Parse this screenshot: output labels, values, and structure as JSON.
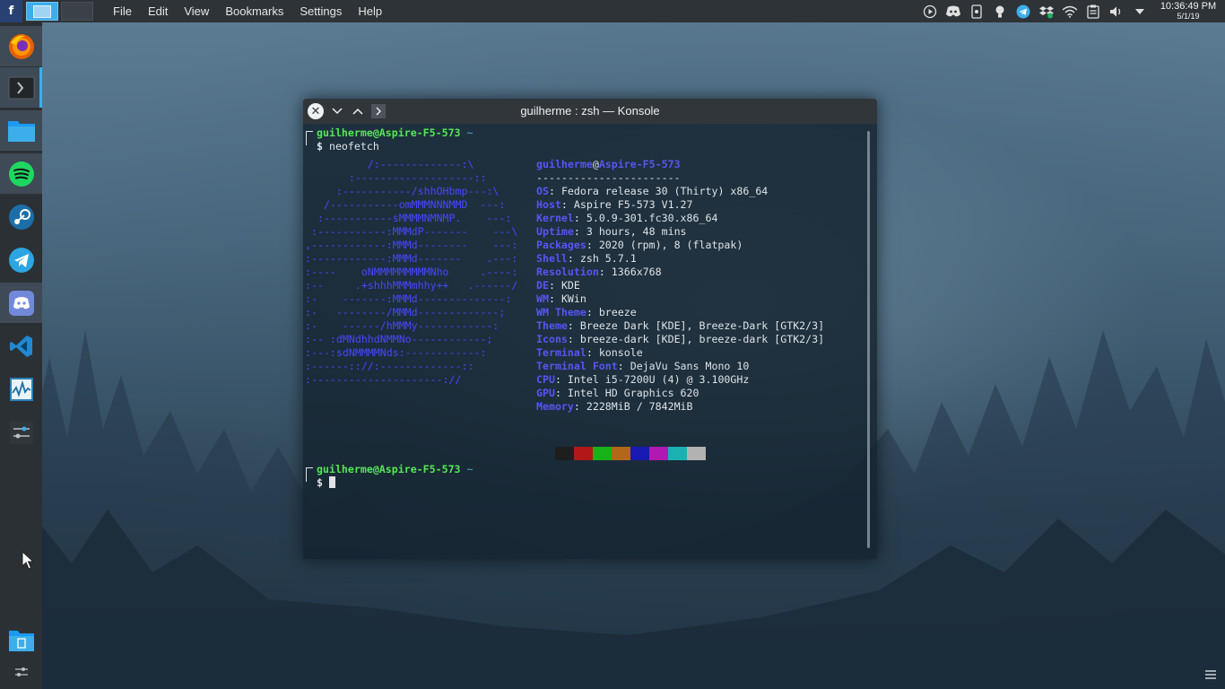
{
  "top_panel": {
    "menu": [
      "File",
      "Edit",
      "View",
      "Bookmarks",
      "Settings",
      "Help"
    ],
    "clock": {
      "time": "10:36:49 PM",
      "date": "5/1/19"
    },
    "tray_icons": [
      "media-play-icon",
      "discord-icon",
      "kde-connect-icon",
      "lightbulb-icon",
      "telegram-icon",
      "dropbox-icon",
      "wifi-icon",
      "clipboard-icon",
      "volume-icon",
      "tray-expand-icon"
    ]
  },
  "dock": {
    "items": [
      "firefox-icon",
      "terminal-icon",
      "file-manager-icon",
      "spotify-icon",
      "steam-icon",
      "telegram-icon",
      "discord-icon",
      "vscode-icon",
      "system-monitor-icon",
      "settings-icon",
      "trash-icon"
    ]
  },
  "window": {
    "title": "guilherme : zsh — Konsole"
  },
  "terminal": {
    "prompt_user": "guilherme@Aspire-F5-573",
    "prompt_dir": "~",
    "prompt_symbol": "$",
    "command": "neofetch",
    "ascii": [
      "          /:-------------:\\",
      "       :-------------------::",
      "     :-----------/shhOHbmp---:\\",
      "   /-----------omMMMNNNMMD  ---:",
      "  :-----------sMMMMNMNMP.    ---:",
      " :-----------:MMMdP-------    ---\\",
      ",------------:MMMd--------    ---:",
      ":------------:MMMd-------    .---:",
      ":----    oNMMMMMMMMMNho     .----:",
      ":--     .+shhhMMMmhhy++   .------/",
      ":-    -------:MMMd--------------:",
      ":-   --------/MMMd-------------;",
      ":-    ------/hMMMy------------:",
      ":-- :dMNdhhdNMMNo------------;",
      ":---:sdNMMMMNds:------------:",
      ":------:://:-------------::",
      ":---------------------://"
    ],
    "info_user": "guilherme",
    "info_at": "@",
    "info_host": "Aspire-F5-573",
    "info_sep": "-----------------------",
    "info": [
      {
        "key": "OS",
        "value": "Fedora release 30 (Thirty) x86_64"
      },
      {
        "key": "Host",
        "value": "Aspire F5-573 V1.27"
      },
      {
        "key": "Kernel",
        "value": "5.0.9-301.fc30.x86_64"
      },
      {
        "key": "Uptime",
        "value": "3 hours, 48 mins"
      },
      {
        "key": "Packages",
        "value": "2020 (rpm), 8 (flatpak)"
      },
      {
        "key": "Shell",
        "value": "zsh 5.7.1"
      },
      {
        "key": "Resolution",
        "value": "1366x768"
      },
      {
        "key": "DE",
        "value": "KDE"
      },
      {
        "key": "WM",
        "value": "KWin"
      },
      {
        "key": "WM Theme",
        "value": "breeze"
      },
      {
        "key": "Theme",
        "value": "Breeze Dark [KDE], Breeze-Dark [GTK2/3]"
      },
      {
        "key": "Icons",
        "value": "breeze-dark [KDE], breeze-dark [GTK2/3]"
      },
      {
        "key": "Terminal",
        "value": "konsole"
      },
      {
        "key": "Terminal Font",
        "value": "DejaVu Sans Mono 10"
      },
      {
        "key": "CPU",
        "value": "Intel i5-7200U (4) @ 3.100GHz"
      },
      {
        "key": "GPU",
        "value": "Intel HD Graphics 620"
      },
      {
        "key": "Memory",
        "value": "2228MiB / 7842MiB"
      }
    ],
    "color_swatches": [
      "#1e1e1e",
      "#b21818",
      "#18b218",
      "#b26818",
      "#1818b2",
      "#b218b2",
      "#18b2b2",
      "#b2b2b2"
    ]
  }
}
